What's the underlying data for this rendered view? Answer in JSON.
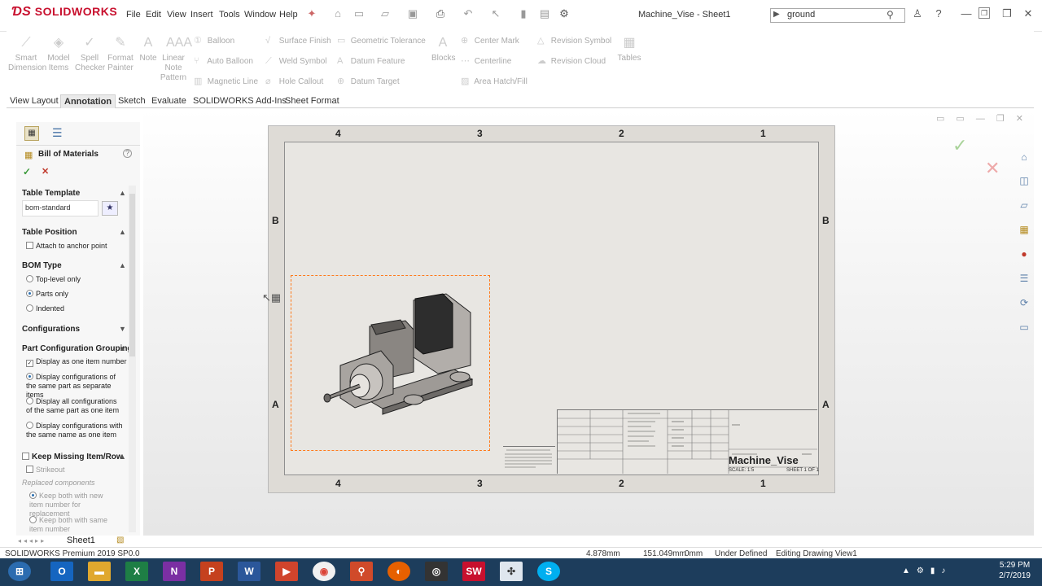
{
  "app": {
    "logo": "SOLIDWORKS",
    "document_title": "Machine_Vise - Sheet1"
  },
  "menu": [
    {
      "label": "File"
    },
    {
      "label": "Edit"
    },
    {
      "label": "View"
    },
    {
      "label": "Insert"
    },
    {
      "label": "Tools"
    },
    {
      "label": "Window"
    },
    {
      "label": "Help"
    }
  ],
  "search": {
    "value": "ground"
  },
  "ribbon": {
    "large": [
      {
        "label": "Smart\nDimension",
        "icon": "smart-dimension-icon"
      },
      {
        "label": "Model\nItems",
        "icon": "model-items-icon"
      },
      {
        "label": "Spell\nChecker",
        "icon": "spell-checker-icon"
      },
      {
        "label": "Format\nPainter",
        "icon": "format-painter-icon"
      },
      {
        "label": "Note",
        "icon": "note-icon"
      },
      {
        "label": "Linear\nNote\nPattern",
        "icon": "linear-note-pattern-icon"
      }
    ],
    "small": [
      {
        "label": "Balloon"
      },
      {
        "label": "Auto Balloon"
      },
      {
        "label": "Magnetic Line"
      },
      {
        "label": "Surface Finish"
      },
      {
        "label": "Weld Symbol"
      },
      {
        "label": "Hole Callout"
      },
      {
        "label": "Geometric Tolerance"
      },
      {
        "label": "Datum Feature"
      },
      {
        "label": "Datum Target"
      },
      {
        "label": "Blocks"
      },
      {
        "label": "Center Mark"
      },
      {
        "label": "Centerline"
      },
      {
        "label": "Area Hatch/Fill"
      },
      {
        "label": "Revision Symbol"
      },
      {
        "label": "Revision Cloud"
      },
      {
        "label": "Tables"
      }
    ]
  },
  "tabs": [
    {
      "label": "View Layout"
    },
    {
      "label": "Annotation"
    },
    {
      "label": "Sketch"
    },
    {
      "label": "Evaluate"
    },
    {
      "label": "SOLIDWORKS Add-Ins"
    },
    {
      "label": "Sheet Format"
    }
  ],
  "active_tab": "Annotation",
  "panel": {
    "title": "Bill of Materials",
    "table_template": {
      "label": "Table Template",
      "value": "bom-standard"
    },
    "table_position": {
      "label": "Table Position",
      "attach": "Attach to anchor point"
    },
    "bom_type": {
      "label": "BOM Type",
      "options": [
        {
          "label": "Top-level only"
        },
        {
          "label": "Parts only"
        },
        {
          "label": "Indented"
        }
      ],
      "selected": "Parts only"
    },
    "configurations": {
      "label": "Configurations"
    },
    "grouping": {
      "label": "Part Configuration Grouping",
      "display_one": "Display as one item number",
      "options": [
        {
          "label": "Display configurations of the same part as separate items"
        },
        {
          "label": "Display all configurations of the same part as one item"
        },
        {
          "label": "Display configurations with the same name as one item"
        }
      ]
    },
    "keep_missing": {
      "label": "Keep Missing Item/Row",
      "strikeout": "Strikeout",
      "replaced": "Replaced components",
      "options": [
        {
          "label": "Keep both with new item number for replacement"
        },
        {
          "label": "Keep both with same item number"
        }
      ]
    }
  },
  "drawing": {
    "zones_top": [
      "4",
      "3",
      "2",
      "1"
    ],
    "zones_side": [
      "B",
      "A"
    ],
    "title_block": {
      "dwg_name": "Machine_Vise",
      "scale": "SCALE: 1:5",
      "sheet": "SHEET 1 OF 1"
    }
  },
  "sheet_tab": "Sheet1",
  "status": {
    "product": "SOLIDWORKS Premium 2019 SP0.0",
    "x": "4.878mm",
    "y": "151.049mm",
    "z": "0mm",
    "state": "Under Defined",
    "editing": "Editing Drawing View1"
  },
  "taskbar": {
    "time": "5:29 PM",
    "date": "2/7/2019"
  }
}
